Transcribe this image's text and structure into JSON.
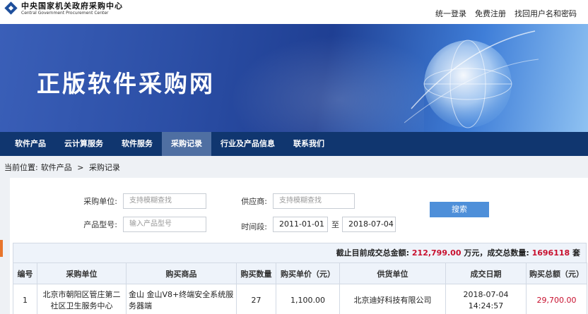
{
  "logo": {
    "cn": "中央国家机关政府采购中心",
    "en": "Central Government Procurement Center"
  },
  "toplinks": [
    "统一登录",
    "免费注册",
    "找回用户名和密码"
  ],
  "banner": {
    "title": "正版软件采购网"
  },
  "nav": [
    "软件产品",
    "云计算服务",
    "软件服务",
    "采购记录",
    "行业及产品信息",
    "联系我们"
  ],
  "nav_active": 3,
  "breadcrumb": {
    "prefix": "当前位置:",
    "items": [
      "软件产品",
      ">",
      "采购记录"
    ]
  },
  "form": {
    "buyer_label": "采购单位:",
    "buyer_placeholder": "支持模糊查找",
    "supplier_label": "供应商:",
    "supplier_placeholder": "支持模糊查找",
    "model_label": "产品型号:",
    "model_placeholder": "输入产品型号",
    "period_label": "时间段:",
    "date_from": "2011-01-01",
    "to_label": "至",
    "date_to": "2018-07-04",
    "search_label": "搜索"
  },
  "summary": {
    "label1": "截止目前成交总金额:",
    "amount": "212,799.00",
    "unit1": "万元，成交总数量:",
    "count": "1696118",
    "unit2": "套"
  },
  "table": {
    "headers": [
      "编号",
      "采购单位",
      "购买商品",
      "购买数量",
      "购买单价（元）",
      "供货单位",
      "成交日期",
      "购买总额（元）"
    ],
    "rows": [
      [
        "1",
        "北京市朝阳区管庄第二社区卫生服务中心",
        "金山 金山V8+终端安全系统服务器端",
        "27",
        "1,100.00",
        "北京迪好科技有限公司",
        "2018-07-04 14:24:57",
        "29,700.00"
      ]
    ]
  },
  "colors": {
    "nav_bg": "#10366f",
    "accent": "#4e8fd9",
    "highlight": "#c8102e"
  }
}
